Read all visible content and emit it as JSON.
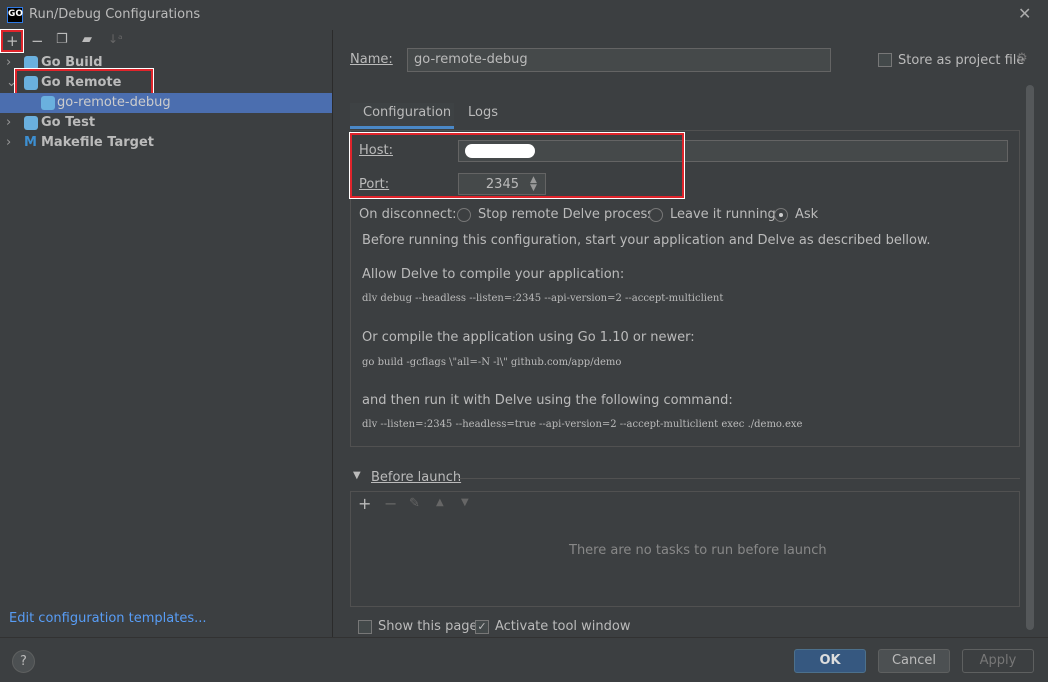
{
  "window": {
    "title": "Run/Debug Configurations",
    "logo": "GO"
  },
  "toolbar": {
    "icons": [
      "plus-icon",
      "minus-icon",
      "copy-icon",
      "folder-add-icon",
      "sort-icon"
    ]
  },
  "tree": [
    {
      "label": "Go Build",
      "expanded": false
    },
    {
      "label": "Go Remote",
      "expanded": true
    },
    {
      "label": "go-remote-debug",
      "selected": true
    },
    {
      "label": "Go Test",
      "expanded": false
    },
    {
      "label": "Makefile Target",
      "expanded": false
    }
  ],
  "edit_templates": "Edit configuration templates...",
  "name_label": "Name:",
  "name_value": "go-remote-debug",
  "store_label": "Store as project file",
  "tabs": [
    "Configuration",
    "Logs"
  ],
  "host_label": "Host:",
  "port_label": "Port:",
  "port_value": "2345",
  "on_disconnect": {
    "label": "On disconnect:",
    "options": [
      "Stop remote Delve process",
      "Leave it running",
      "Ask"
    ],
    "selected": "Ask"
  },
  "help": {
    "intro": "Before running this configuration, start your application and Delve as described bellow.",
    "allow": "Allow Delve to compile your application:",
    "cmd1": "dlv debug --headless --listen=:2345 --api-version=2 --accept-multiclient",
    "or": "Or compile the application using Go 1.10 or newer:",
    "cmd2": "go build -gcflags \\\"all=-N -l\\\" github.com/app/demo",
    "then": "and then run it with Delve using the following command:",
    "cmd3": "dlv --listen=:2345 --headless=true --api-version=2 --accept-multiclient exec ./demo.exe"
  },
  "before_launch": {
    "label": "Before launch",
    "empty": "There are no tasks to run before launch"
  },
  "show_page": "Show this page",
  "activate": "Activate tool window",
  "buttons": {
    "ok": "OK",
    "cancel": "Cancel",
    "apply": "Apply"
  },
  "colors": {
    "accent": "#365880",
    "selection": "#4b6eaf",
    "highlight": "#e0242b",
    "link": "#589df6"
  }
}
